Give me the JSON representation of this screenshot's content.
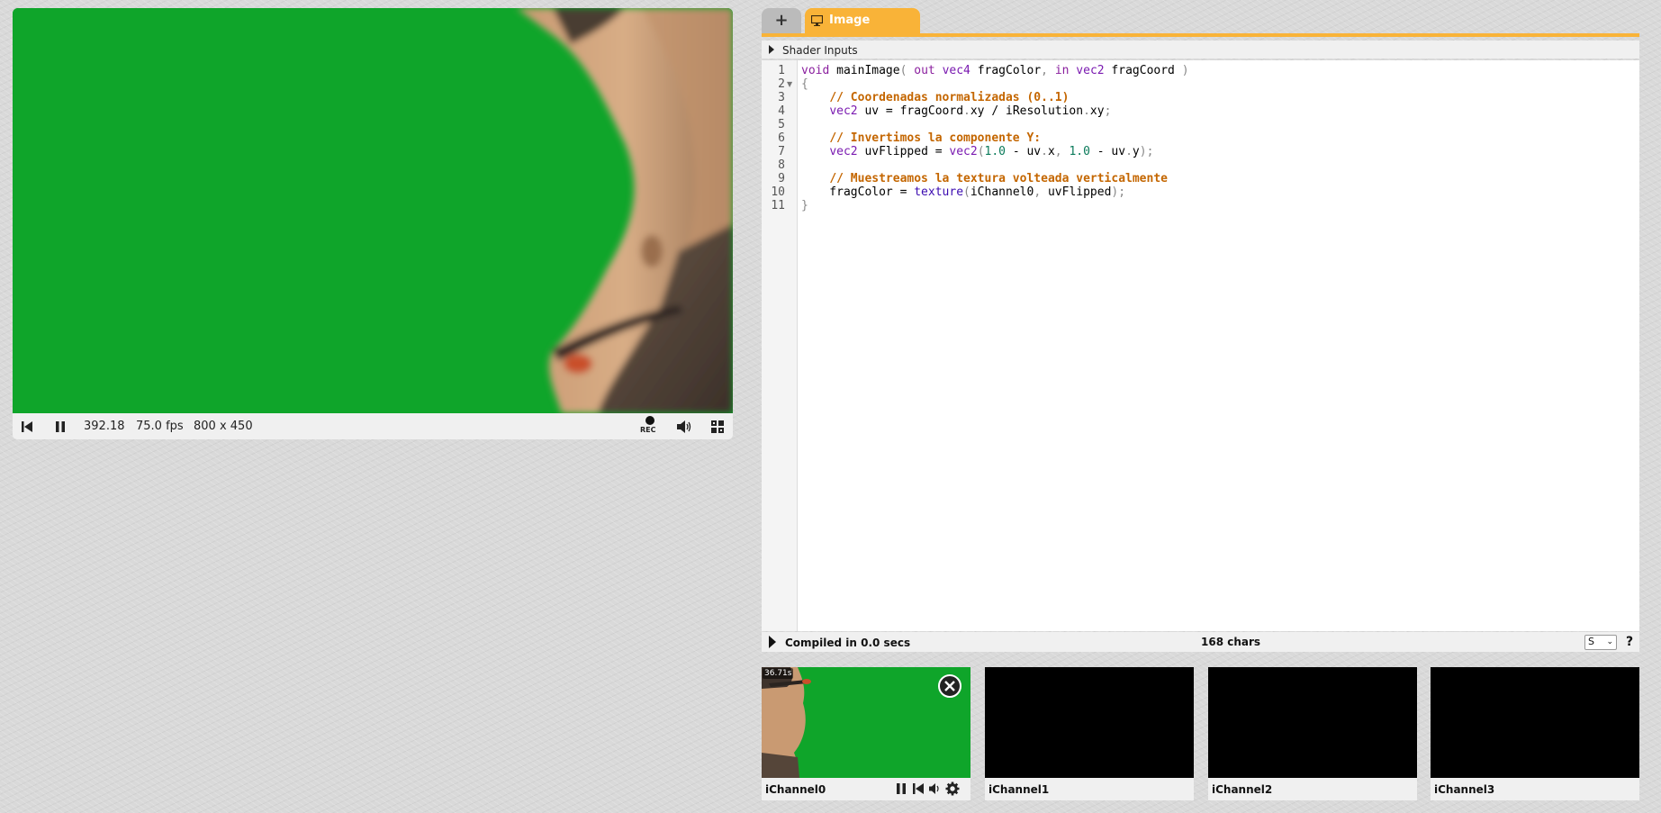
{
  "player": {
    "time": "392.18",
    "fps": "75.0 fps",
    "resolution": "800 x 450",
    "rec_label": "REC",
    "icons": {
      "rewind": "skip-back-icon",
      "pause": "pause-icon",
      "record": "record-icon",
      "volume": "volume-icon",
      "fullscreen": "fullscreen-icon"
    }
  },
  "tabs": {
    "add_label": "+",
    "image_label": "Image",
    "image_icon": "monitor-icon"
  },
  "shader_inputs_label": "Shader Inputs",
  "editor": {
    "line_numbers": [
      "1",
      "2",
      "3",
      "4",
      "5",
      "6",
      "7",
      "8",
      "9",
      "10",
      "11"
    ],
    "lines": [
      "void mainImage( out vec4 fragColor, in vec2 fragCoord )",
      "{",
      "    // Coordenadas normalizadas (0..1)",
      "    vec2 uv = fragCoord.xy / iResolution.xy;",
      "",
      "    // Invertimos la componente Y:",
      "    vec2 uvFlipped = vec2(1.0 - uv.x, 1.0 - uv.y);",
      "",
      "    // Muestreamos la textura volteada verticalmente",
      "    fragColor = texture(iChannel0, uvFlipped);",
      "}"
    ]
  },
  "status": {
    "compiled": "Compiled in 0.0 secs",
    "chars": "168 chars",
    "font_size": "S",
    "help": "?"
  },
  "channels": [
    {
      "label": "iChannel0",
      "time": "36.71s",
      "active": true
    },
    {
      "label": "iChannel1",
      "active": false
    },
    {
      "label": "iChannel2",
      "active": false
    },
    {
      "label": "iChannel3",
      "active": false
    }
  ],
  "colors": {
    "accent": "#f9b338",
    "green_screen": "#0fa52a",
    "bar_bg": "#f0f0f0"
  }
}
